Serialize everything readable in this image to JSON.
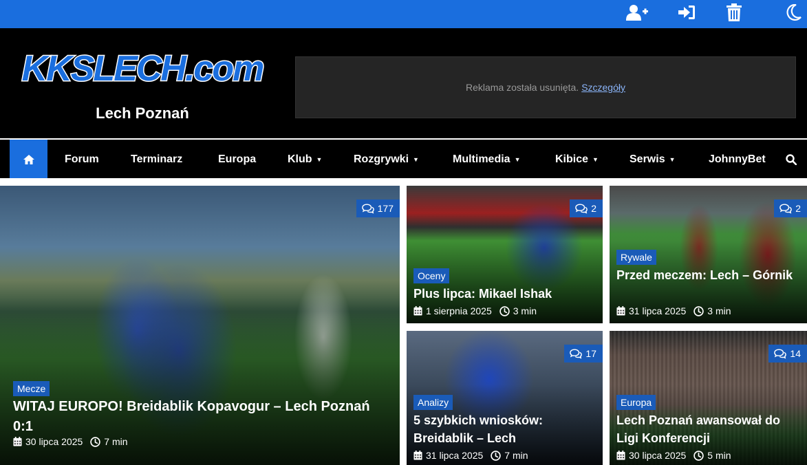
{
  "topbar": {
    "icons": [
      "user-plus-icon",
      "sign-in-icon",
      "trash-icon",
      "moon-icon"
    ]
  },
  "header": {
    "logo_text": "KKSLECH.com",
    "tagline": "Lech Poznań",
    "ad_text": "Reklama została usunięta.",
    "ad_link": "Szczegóły"
  },
  "nav": {
    "home_icon": "home-icon",
    "items": [
      {
        "label": "Forum",
        "dropdown": false
      },
      {
        "label": "Terminarz",
        "dropdown": false
      },
      {
        "label": "Europa",
        "dropdown": false
      },
      {
        "label": "Klub",
        "dropdown": true
      },
      {
        "label": "Rozgrywki",
        "dropdown": true
      },
      {
        "label": "Multimedia",
        "dropdown": true
      },
      {
        "label": "Kibice",
        "dropdown": true
      },
      {
        "label": "Serwis",
        "dropdown": true
      },
      {
        "label": "JohnnyBet",
        "dropdown": false
      }
    ],
    "search_icon": "search-icon"
  },
  "colors": {
    "accent": "#1a6ede",
    "badge": "#1a5bb8",
    "header_bg": "#000000"
  },
  "articles": [
    {
      "category": "Mecze",
      "title": "WITAJ EUROPO! Breidablik Kopavogur – Lech Poznań 0:1",
      "date": "30 lipca 2025",
      "read_time": "7 min",
      "comments": "177"
    },
    {
      "category": "Oceny",
      "title": "Plus lipca: Mikael Ishak",
      "date": "1 sierpnia 2025",
      "read_time": "3 min",
      "comments": "2"
    },
    {
      "category": "Rywale",
      "title": "Przed meczem: Lech – Górnik",
      "date": "31 lipca 2025",
      "read_time": "3 min",
      "comments": "2"
    },
    {
      "category": "Analizy",
      "title": "5 szybkich wniosków: Breidablik – Lech",
      "date": "31 lipca 2025",
      "read_time": "7 min",
      "comments": "17"
    },
    {
      "category": "Europa",
      "title": "Lech Poznań awansował do Ligi Konferencji",
      "date": "30 lipca 2025",
      "read_time": "5 min",
      "comments": "14"
    }
  ]
}
